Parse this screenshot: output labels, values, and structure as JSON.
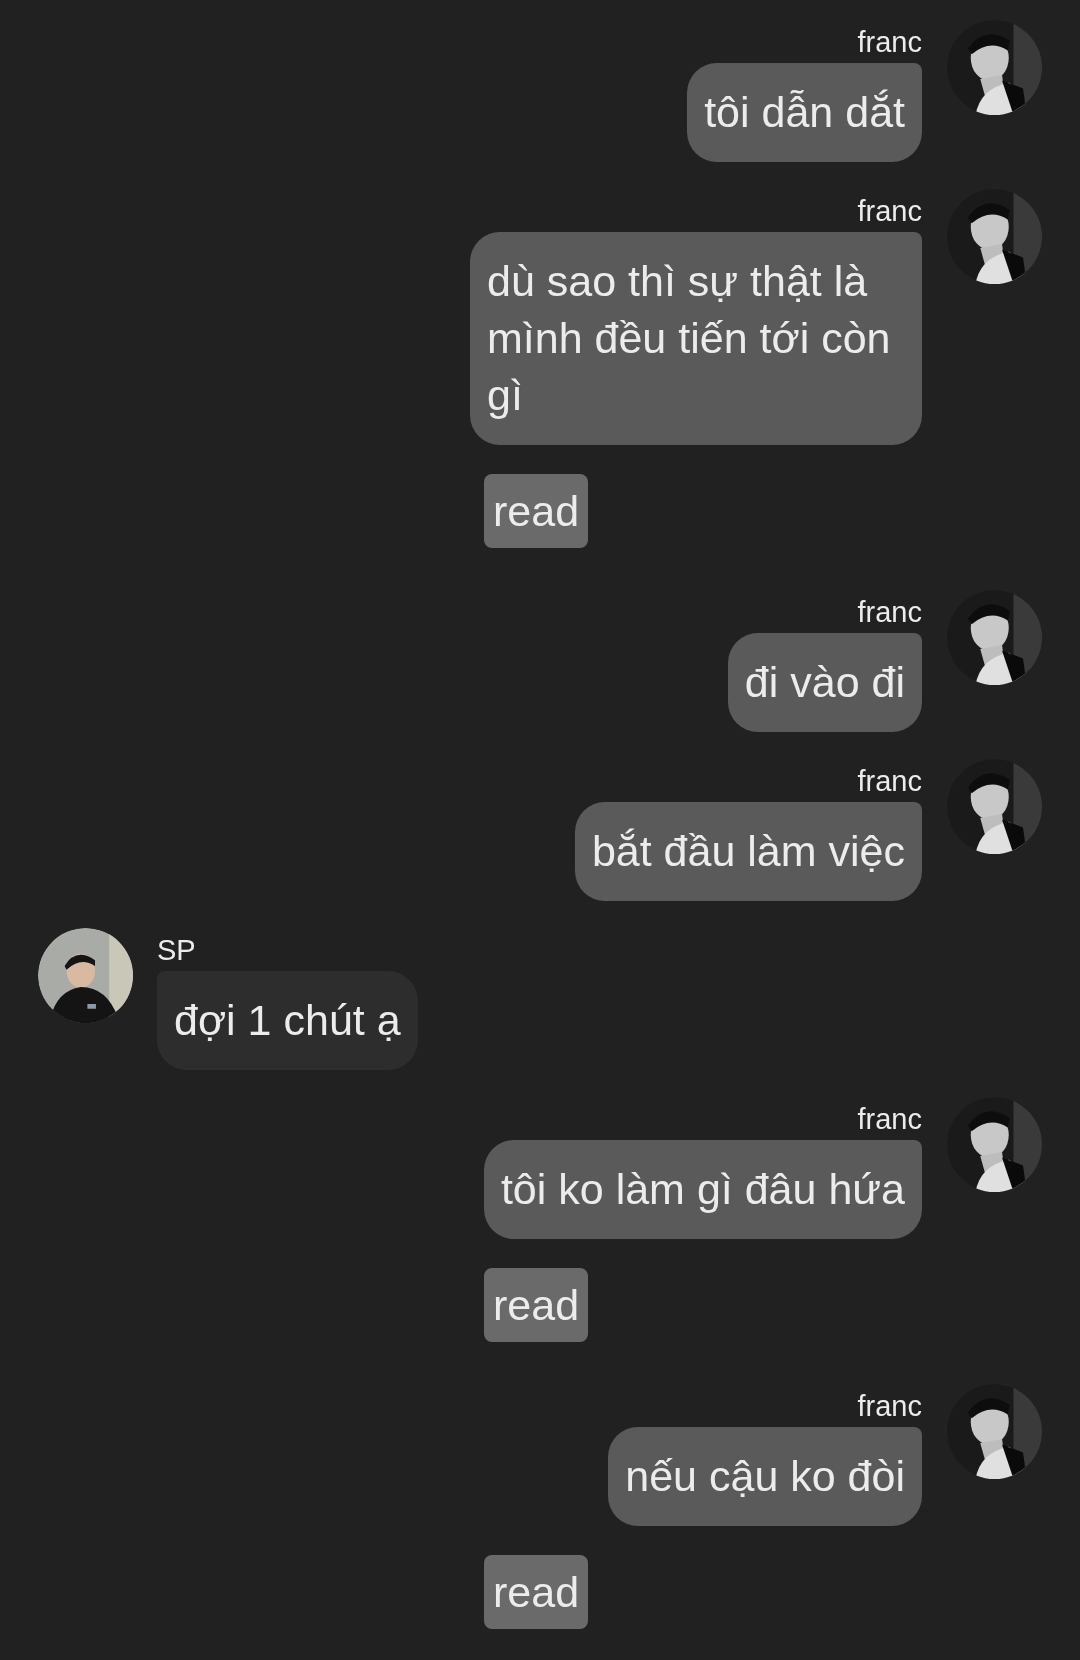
{
  "messages": [
    {
      "kind": "outgoing",
      "sender": "franc",
      "text": "tôi dẫn dắt"
    },
    {
      "kind": "outgoing",
      "sender": "franc",
      "text": "dù sao thì sự thật là mình đều tiến tới còn gì"
    },
    {
      "kind": "receipt",
      "text": "read"
    },
    {
      "kind": "outgoing",
      "sender": "franc",
      "text": "đi vào đi"
    },
    {
      "kind": "outgoing",
      "sender": "franc",
      "text": "bắt đầu làm việc"
    },
    {
      "kind": "incoming",
      "sender": "SP",
      "text": "đợi 1 chút ạ"
    },
    {
      "kind": "outgoing",
      "sender": "franc",
      "text": "tôi ko làm gì đâu hứa"
    },
    {
      "kind": "receipt",
      "text": "read"
    },
    {
      "kind": "outgoing",
      "sender": "franc",
      "text": "nếu cậu ko đòi"
    },
    {
      "kind": "receipt",
      "text": "read"
    }
  ]
}
